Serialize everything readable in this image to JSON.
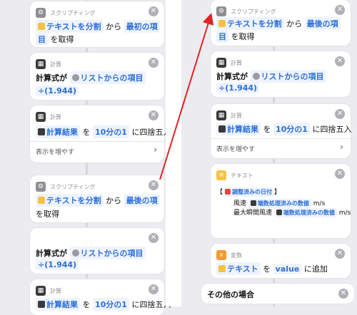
{
  "left": {
    "card1": {
      "header": "スクリプティング",
      "text": "テキストを分割",
      "from": "から",
      "item": "最初の項",
      "item2": "目",
      "tail": "を取得"
    },
    "card2": {
      "header": "計算",
      "formula_label": "計算式が",
      "list_item": "リストからの項目",
      "divisor": "÷(1.944)"
    },
    "card3": {
      "header": "計算",
      "result": "計算結果",
      "wo": "を",
      "unit": "10分の1",
      "round": "に四捨五入",
      "more": "表示を増やす"
    },
    "card4": {
      "header": "スクリプティング",
      "text": "テキストを分割",
      "from": "から",
      "item": "最後の項",
      "tail": "を取得"
    },
    "card5": {
      "formula_label": "計算式が",
      "list_item": "リストからの項目",
      "divisor": "÷(1.944)"
    },
    "card6": {
      "header": "計算",
      "result": "計算結果",
      "wo": "を",
      "unit": "10分の1",
      "round": "に四捨五入"
    }
  },
  "right": {
    "card1": {
      "header": "スクリプティング",
      "text": "テキストを分割",
      "from": "から",
      "item": "最後の項",
      "item2": "目",
      "tail": "を取得"
    },
    "card2": {
      "header": "計算",
      "formula_label": "計算式が",
      "list_item": "リストからの項目",
      "divisor": "÷(1.944)"
    },
    "card3": {
      "header": "計算",
      "result": "計算結果",
      "wo": "を",
      "unit": "10分の1",
      "round": "に四捨五入",
      "more": "表示を増やす"
    },
    "card4": {
      "header": "テキスト",
      "bracket": "【",
      "date": "調整済みの日付",
      "bracket_close": "】",
      "wind": "風速",
      "wind_val": "端数処理済みの数値",
      "wind_unit": "m/s",
      "gust": "最大瞬間風速",
      "gust_val": "端数処理済みの数値",
      "gust_unit": "m/s"
    },
    "card5": {
      "header": "変数",
      "text": "テキスト",
      "wo": "を",
      "var": "value",
      "add": "に追加"
    },
    "otherwise": "その他の場合"
  },
  "colors": {
    "accent": "#2c6fd6",
    "arrow": "#e02424",
    "background": "#ececf0"
  }
}
